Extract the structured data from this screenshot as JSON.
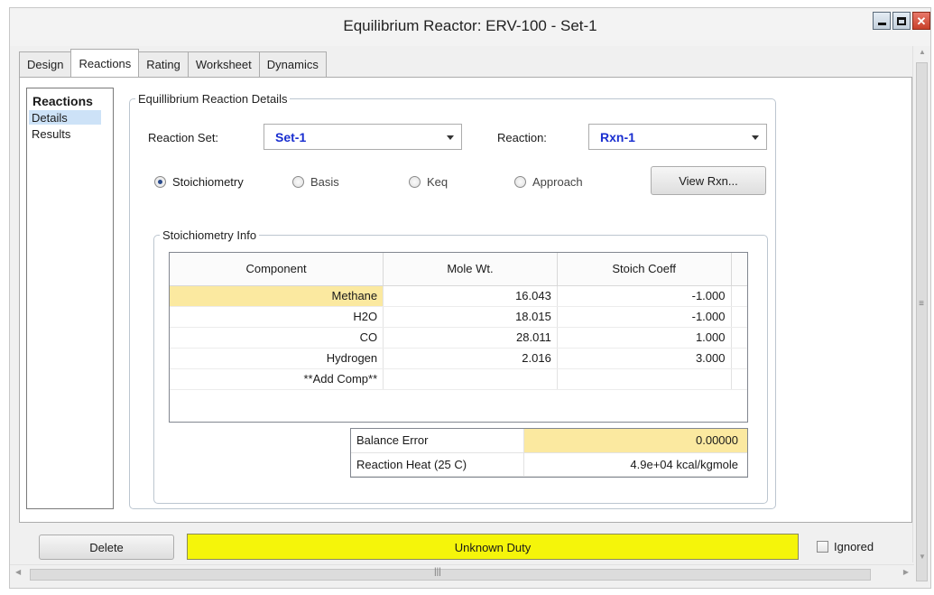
{
  "window": {
    "title": "Equilibrium Reactor: ERV-100 - Set-1",
    "controls": [
      "minimize",
      "maximize",
      "close"
    ]
  },
  "tabs": [
    {
      "label": "Design",
      "active": false
    },
    {
      "label": "Reactions",
      "active": true
    },
    {
      "label": "Rating",
      "active": false
    },
    {
      "label": "Worksheet",
      "active": false
    },
    {
      "label": "Dynamics",
      "active": false
    }
  ],
  "nav": {
    "title": "Reactions",
    "items": [
      {
        "label": "Details",
        "selected": true
      },
      {
        "label": "Results",
        "selected": false
      }
    ]
  },
  "details": {
    "legend": "Equillibrium Reaction Details",
    "reaction_set_label": "Reaction Set:",
    "reaction_set_value": "Set-1",
    "reaction_label": "Reaction:",
    "reaction_value": "Rxn-1",
    "radios": [
      {
        "label": "Stoichiometry",
        "checked": true
      },
      {
        "label": "Basis",
        "checked": false
      },
      {
        "label": "Keq",
        "checked": false
      },
      {
        "label": "Approach",
        "checked": false
      }
    ],
    "view_button": "View Rxn..."
  },
  "stoich": {
    "legend": "Stoichiometry Info",
    "columns": [
      "Component",
      "Mole Wt.",
      "Stoich Coeff"
    ],
    "rows": [
      {
        "component": "Methane",
        "mw": "16.043",
        "coeff": "-1.000"
      },
      {
        "component": "H2O",
        "mw": "18.015",
        "coeff": "-1.000"
      },
      {
        "component": "CO",
        "mw": "28.011",
        "coeff": "1.000"
      },
      {
        "component": "Hydrogen",
        "mw": "2.016",
        "coeff": "3.000"
      },
      {
        "component": "**Add Comp**",
        "mw": "",
        "coeff": ""
      }
    ],
    "balance_error_label": "Balance Error",
    "balance_error_value": "0.00000",
    "reaction_heat_label": "Reaction Heat (25 C)",
    "reaction_heat_value": "4.9e+04 kcal/kgmole"
  },
  "status": {
    "delete_label": "Delete",
    "duty_text": "Unknown Duty",
    "duty_color": "#f5f50a",
    "ignored_label": "Ignored",
    "ignored_checked": false
  },
  "colors": {
    "highlight": "#fbe9a0",
    "value_text": "#1a2fd0",
    "nav_selected": "#cde2f7"
  }
}
